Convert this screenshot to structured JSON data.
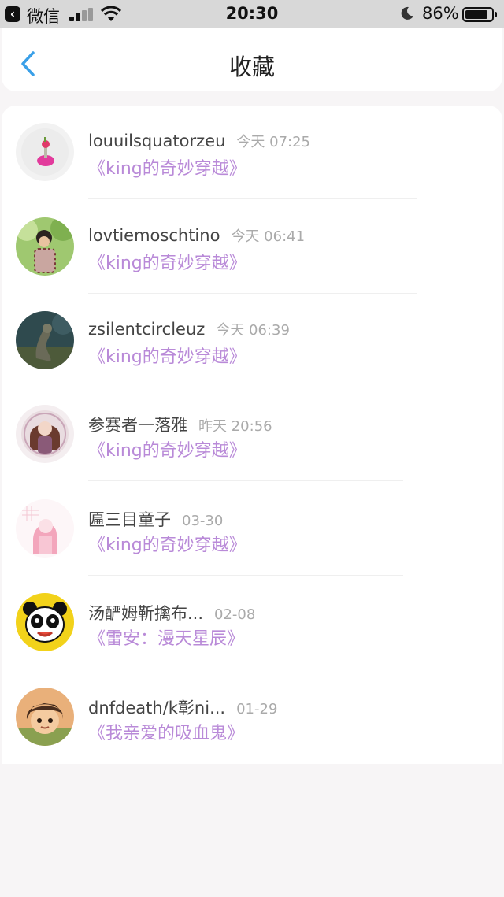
{
  "status_bar": {
    "back_app": "微信",
    "time": "20:30",
    "battery_percent": "86%"
  },
  "nav": {
    "title": "收藏"
  },
  "favorites": [
    {
      "user": "louuilsquatorzeu",
      "time": "今天 07:25",
      "book": "《king的奇妙穿越》"
    },
    {
      "user": "lovtiemoschtino",
      "time": "今天 06:41",
      "book": "《king的奇妙穿越》"
    },
    {
      "user": "zsilentcircleuz",
      "time": "今天 06:39",
      "book": "《king的奇妙穿越》"
    },
    {
      "user": "参赛者一落雅",
      "time": "昨天 20:56",
      "book": "《king的奇妙穿越》"
    },
    {
      "user": "匾三目童子",
      "time": "03-30",
      "book": "《king的奇妙穿越》"
    },
    {
      "user": "汤酽姆靳擒布...",
      "time": "02-08",
      "book": "《雷安：漫天星辰》"
    },
    {
      "user": "dnfdeath/k彰ni...",
      "time": "01-29",
      "book": "《我亲爱的吸血鬼》"
    }
  ]
}
